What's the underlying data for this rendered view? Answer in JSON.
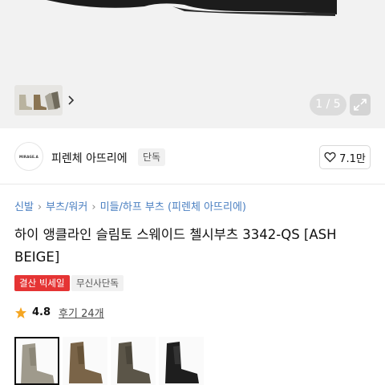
{
  "gallery": {
    "counter": "1 / 5",
    "thumbnail_icon": "boots-thumbnail",
    "next_icon": "chevron-right-icon",
    "expand_icon": "expand-icon"
  },
  "brand": {
    "logo_text": "MIRAGE.A",
    "name": "피렌체 아뜨리에",
    "badge": "단독",
    "likes": "7.1만",
    "like_icon": "heart-outline-icon"
  },
  "breadcrumb": [
    "신발",
    "부츠/워커",
    "미들/하프 부츠",
    "(피렌체 아뜨리에)"
  ],
  "product": {
    "title": "하이 앵클라인 슬림토 스웨이드 첼시부츠 3342-QS [ASH BEIGE]",
    "tags": [
      "결산 빅세일",
      "무신사단독"
    ],
    "rating": "4.8",
    "reviews": "후기 24개",
    "star_color": "#f5a623"
  },
  "colors": {
    "accent_red": "#e53434",
    "link_blue": "#4a7fc1"
  },
  "color_options": [
    "ash-beige",
    "brown",
    "dark-olive",
    "black"
  ]
}
